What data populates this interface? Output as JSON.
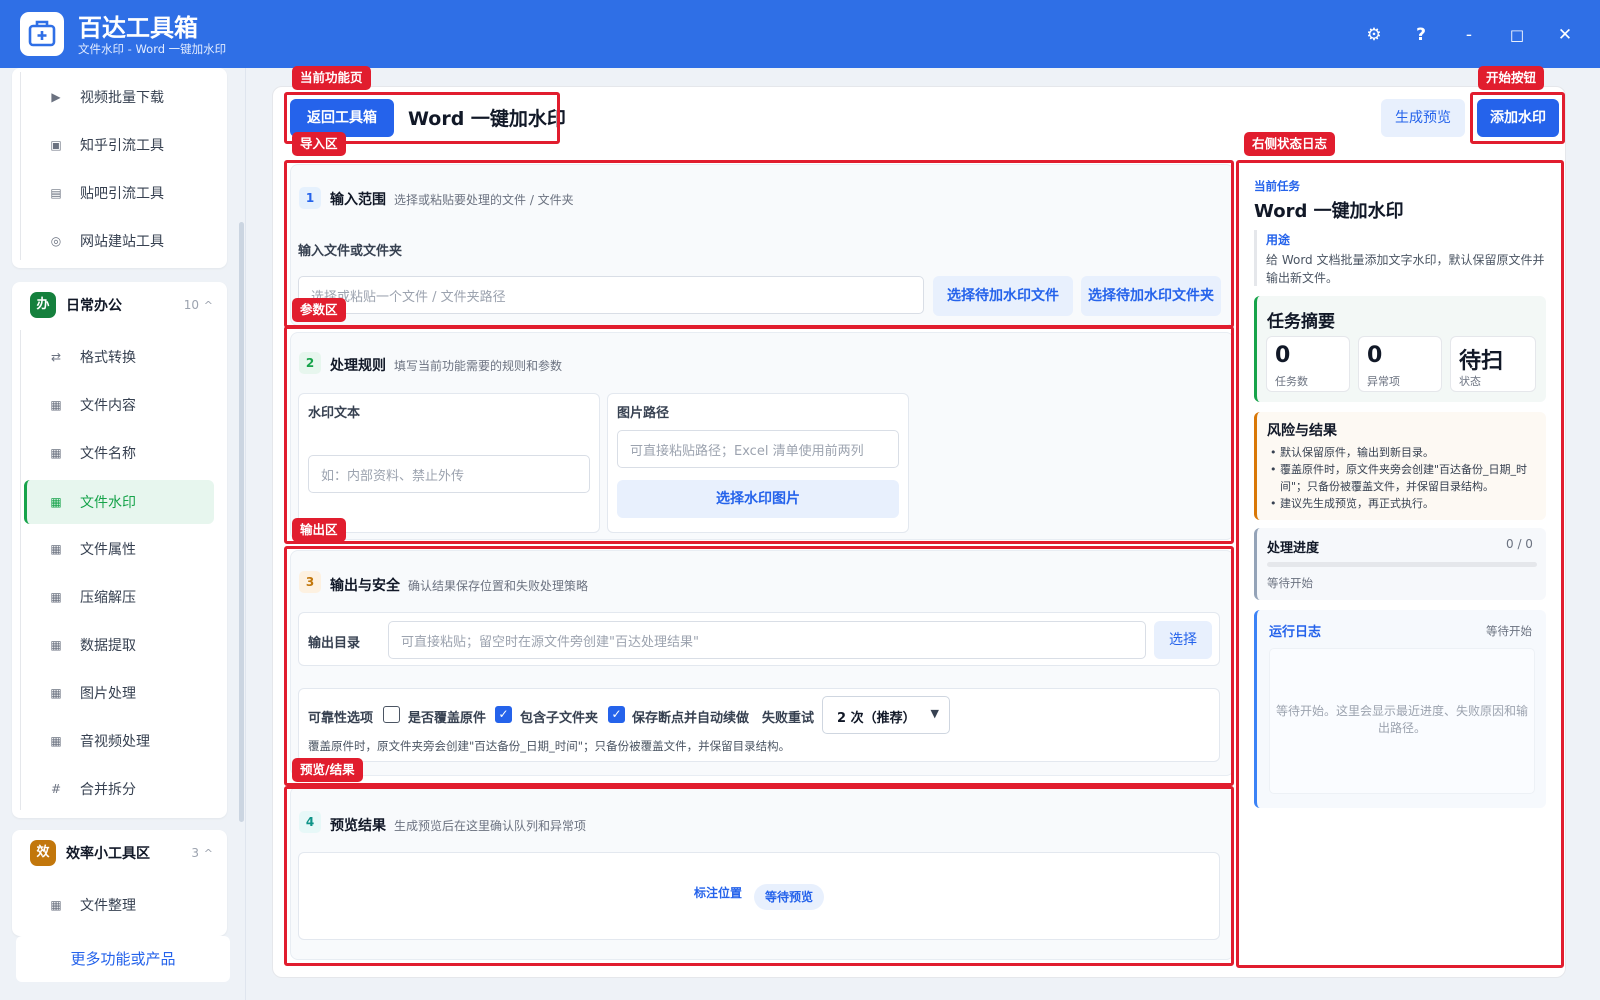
{
  "app": {
    "title": "百达工具箱",
    "subtitle": "文件水印 - Word 一键加水印"
  },
  "window_controls": {
    "settings": "⚙",
    "help": "?",
    "minimize": "-",
    "maximize": "□",
    "close": "✕"
  },
  "sidebar": {
    "items_top": [
      "视频批量下载",
      "知乎引流工具",
      "贴吧引流工具",
      "网站建站工具"
    ],
    "group_office": {
      "badge": "办",
      "name": "日常办公",
      "count": "10",
      "caret": "^"
    },
    "items_office": [
      "格式转换",
      "文件内容",
      "文件名称",
      "文件水印",
      "文件属性",
      "压缩解压",
      "数据提取",
      "图片处理",
      "音视频处理",
      "合并拆分"
    ],
    "active_item": "文件水印",
    "group_eff": {
      "badge": "效",
      "name": "效率小工具区",
      "count": "3",
      "caret": "^"
    },
    "items_eff": [
      "文件整理"
    ],
    "more_link": "更多功能或产品",
    "colors": {
      "office_badge": "#15803d",
      "eff_badge": "#c2770c"
    }
  },
  "header": {
    "back_button": "返回工具箱",
    "title": "Word 一键加水印",
    "preview_button": "生成预览",
    "start_button": "添加水印"
  },
  "section1": {
    "num": "1",
    "title": "输入范围",
    "desc": "选择或粘贴要处理的文件 / 文件夹",
    "field_label": "输入文件或文件夹",
    "placeholder": "选择或粘贴一个文件 / 文件夹路径",
    "btn_file": "选择待加水印文件",
    "btn_folder": "选择待加水印文件夹"
  },
  "section2": {
    "num": "2",
    "title": "处理规则",
    "desc": "填写当前功能需要的规则和参数",
    "watermark_label": "水印文本",
    "watermark_placeholder": "如：内部资料、禁止外传",
    "image_label": "图片路径",
    "image_placeholder": "可直接粘贴路径；Excel 清单使用前两列",
    "image_button": "选择水印图片"
  },
  "section3": {
    "num": "3",
    "title": "输出与安全",
    "desc": "确认结果保存位置和失败处理策略",
    "output_label": "输出目录",
    "output_placeholder": "可直接粘贴；留空时在源文件旁创建\"百达处理结果\"",
    "output_button": "选择",
    "reliability_label": "可靠性选项",
    "opt_overwrite": "是否覆盖原件",
    "opt_overwrite_checked": false,
    "opt_subfolder": "包含子文件夹",
    "opt_subfolder_checked": true,
    "opt_resume": "保存断点并自动续做",
    "opt_resume_checked": true,
    "retry_label": "失败重试",
    "retry_value": "2 次（推荐）",
    "note": "覆盖原件时，原文件夹旁会创建\"百达备份_日期_时间\"；只备份被覆盖文件，并保留目录结构。"
  },
  "section4": {
    "num": "4",
    "title": "预览结果",
    "desc": "生成预览后在这里确认队列和异常项",
    "mark_label": "标注位置",
    "status_badge": "等待预览"
  },
  "right_panel": {
    "current_task_label": "当前任务",
    "task_title": "Word 一键加水印",
    "purpose_label": "用途",
    "purpose_text": "给 Word 文档批量添加文字水印，默认保留原文件并输出新文件。",
    "summary_title": "任务摘要",
    "stats": [
      {
        "value": "0",
        "label": "任务数"
      },
      {
        "value": "0",
        "label": "异常项"
      },
      {
        "value": "待扫",
        "label": "状态"
      }
    ],
    "risk_title": "风险与结果",
    "risk_items": [
      "默认保留原件，输出到新目录。",
      "覆盖原件时，原文件夹旁会创建\"百达备份_日期_时间\"；只备份被覆盖文件，并保留目录结构。",
      "建议先生成预览，再正式执行。"
    ],
    "progress_title": "处理进度",
    "progress_count": "0 / 0",
    "progress_value": 0,
    "progress_status": "等待开始",
    "log_title": "运行日志",
    "log_status": "等待开始",
    "log_placeholder": "等待开始。这里会显示最近进度、失败原因和输出路径。"
  },
  "annotations": {
    "current_page": "当前功能页",
    "start_button": "开始按钮",
    "import_area": "导入区",
    "right_log": "右侧状态日志",
    "param_area": "参数区",
    "output_area": "输出区",
    "preview_area": "预览/结果"
  }
}
